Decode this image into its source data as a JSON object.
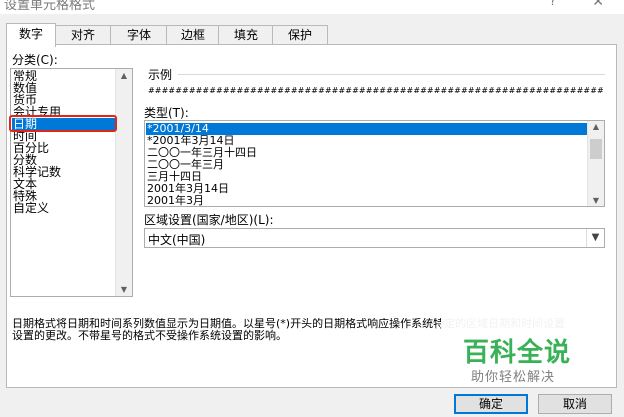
{
  "window": {
    "title": "设置单元格格式",
    "help": "?",
    "close": "✕"
  },
  "tabs": [
    {
      "label": "数字",
      "active": true
    },
    {
      "label": "对齐"
    },
    {
      "label": "字体"
    },
    {
      "label": "边框"
    },
    {
      "label": "填充"
    },
    {
      "label": "保护"
    }
  ],
  "category": {
    "label": "分类(C):",
    "items": [
      "常规",
      "数值",
      "货币",
      "会计专用",
      "日期",
      "时间",
      "百分比",
      "分数",
      "科学记数",
      "文本",
      "特殊",
      "自定义"
    ],
    "selected": "日期"
  },
  "sample": {
    "label": "示例",
    "value": "########################################################################################################################"
  },
  "type": {
    "label": "类型(T):",
    "items": [
      "*2001/3/14",
      "*2001年3月14日",
      "二〇〇一年三月十四日",
      "二〇〇一年三月",
      "三月十四日",
      "2001年3月14日",
      "2001年3月"
    ],
    "selected": "*2001/3/14"
  },
  "locale": {
    "label": "区域设置(国家/地区)(L):",
    "value": "中文(中国)"
  },
  "description": {
    "line1": "日期格式将日期和时间系列数值显示为日期值。以星号(*)开头的日期格式响应操作系统特定的区域日期和时间设置",
    "line2": "设置的更改。不带星号的格式不受操作系统设置的影响。"
  },
  "buttons": {
    "ok": "确定",
    "cancel": "取消"
  },
  "watermark": {
    "main": "百科全说",
    "sub": "助你轻松解决"
  },
  "colors": {
    "selection": "#0078d7",
    "highlight_box": "#e0261a",
    "watermark": "#2fae4f"
  }
}
